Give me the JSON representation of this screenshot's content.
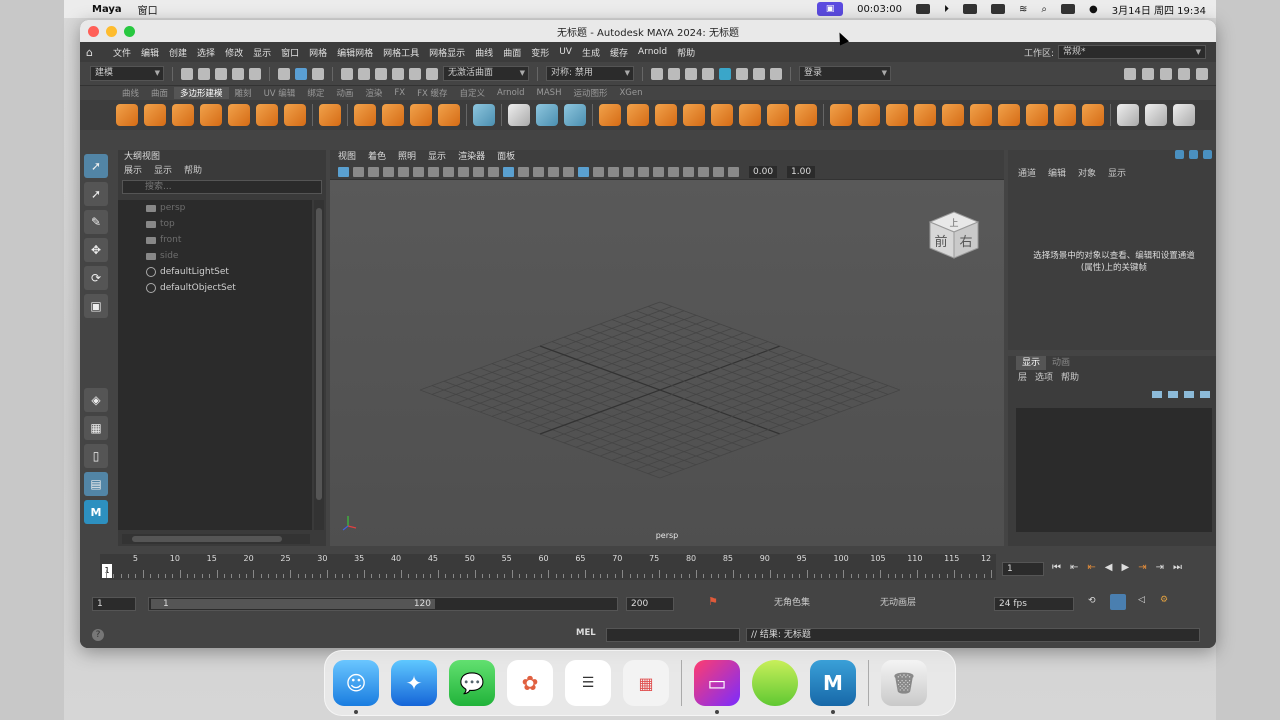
{
  "menubar": {
    "app_name": "Maya",
    "menu_window": "窗口",
    "recording_time": "00:03:00",
    "date_time": "3月14日 周四  19:34"
  },
  "window": {
    "title": "无标题 - Autodesk MAYA 2024: 无标题"
  },
  "main_menu": {
    "items": [
      "文件",
      "编辑",
      "创建",
      "选择",
      "修改",
      "显示",
      "窗口",
      "网格",
      "编辑网格",
      "网格工具",
      "网格显示",
      "曲线",
      "曲面",
      "变形",
      "UV",
      "生成",
      "缓存",
      "Arnold",
      "帮助"
    ],
    "workspace_label": "工作区:",
    "workspace_value": "常规*"
  },
  "status_line": {
    "mode": "建模",
    "live_surface": "无激活曲面",
    "symmetry": "对称: 禁用",
    "login": "登录"
  },
  "shelf": {
    "tabs": [
      "曲线",
      "曲面",
      "多边形建模",
      "雕刻",
      "UV 编辑",
      "绑定",
      "动画",
      "渲染",
      "FX",
      "FX 缓存",
      "自定义",
      "Arnold",
      "MASH",
      "运动图形",
      "XGen"
    ],
    "active_tab": "多边形建模"
  },
  "outliner": {
    "title": "大纲视图",
    "menu": [
      "展示",
      "显示",
      "帮助"
    ],
    "search_placeholder": "搜索...",
    "items": [
      {
        "label": "persp",
        "dim": true
      },
      {
        "label": "top",
        "dim": true
      },
      {
        "label": "front",
        "dim": true
      },
      {
        "label": "side",
        "dim": true
      },
      {
        "label": "defaultLightSet",
        "dim": false
      },
      {
        "label": "defaultObjectSet",
        "dim": false
      }
    ]
  },
  "viewport": {
    "menu": [
      "视图",
      "着色",
      "照明",
      "显示",
      "渲染器",
      "面板"
    ],
    "value_a": "0.00",
    "value_b": "1.00",
    "camera_label": "persp",
    "cube_front": "前",
    "cube_right": "右",
    "cube_top": "上"
  },
  "attribute_panel": {
    "menu": [
      "通道",
      "编辑",
      "对象",
      "显示"
    ],
    "message": "选择场景中的对象以查看、编辑和设置通道(属性)上的关键帧"
  },
  "layer_editor": {
    "tabs": [
      "显示",
      "动画"
    ],
    "menu": [
      "层",
      "选项",
      "帮助"
    ]
  },
  "time_slider": {
    "ticks": [
      "5",
      "10",
      "15",
      "20",
      "25",
      "30",
      "35",
      "40",
      "45",
      "50",
      "55",
      "60",
      "65",
      "70",
      "75",
      "80",
      "85",
      "90",
      "95",
      "100",
      "105",
      "110",
      "115",
      "12"
    ],
    "current_frame_marker": "1",
    "current_frame": "1"
  },
  "range_slider": {
    "start": "1",
    "range_start": "1",
    "range_end": "120",
    "end": "200",
    "character_set": "无角色集",
    "anim_layer": "无动画层",
    "fps": "24 fps"
  },
  "command_line": {
    "mel_label": "MEL",
    "result": "// 结果: 无标题"
  },
  "dock": {
    "apps": [
      "finder",
      "safari",
      "messages",
      "photos",
      "reminders",
      "launchpad",
      "screen-recorder",
      "vpn",
      "maya",
      "trash"
    ],
    "maya_label": "M"
  }
}
